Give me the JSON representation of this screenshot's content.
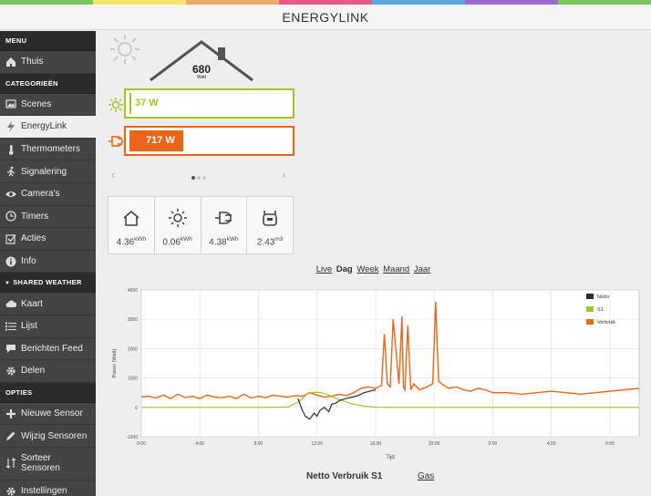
{
  "app": {
    "title": "ENERGYLINK"
  },
  "rainbow": [
    "#7ac75a",
    "#f2e66a",
    "#f0a96a",
    "#e65a8a",
    "#5aa7e0",
    "#9a6ad0",
    "#7ac75a"
  ],
  "sidebar": {
    "sections": [
      {
        "label": "MENU",
        "items": [
          {
            "label": "Thuis",
            "icon": "home-icon"
          }
        ]
      },
      {
        "label": "CATEGORIEËN",
        "items": [
          {
            "label": "Scenes",
            "icon": "image-icon"
          },
          {
            "label": "EnergyLink",
            "icon": "lightning-icon",
            "active": true
          },
          {
            "label": "Thermometers",
            "icon": "thermometer-icon"
          },
          {
            "label": "Signalering",
            "icon": "running-man-icon"
          },
          {
            "label": "Camera's",
            "icon": "eye-icon"
          },
          {
            "label": "Timers",
            "icon": "clock-icon"
          },
          {
            "label": "Acties",
            "icon": "checkbox-icon"
          },
          {
            "label": "Info",
            "icon": "info-icon"
          }
        ]
      },
      {
        "label": "SHARED WEATHER",
        "items": [
          {
            "label": "Kaart",
            "icon": "cloud-icon"
          },
          {
            "label": "Lijst",
            "icon": "list-icon"
          },
          {
            "label": "Berichten Feed",
            "icon": "chat-icon"
          },
          {
            "label": "Delen",
            "icon": "gear-icon"
          }
        ]
      },
      {
        "label": "OPTIES",
        "items": [
          {
            "label": "Nieuwe Sensor",
            "icon": "plus-icon"
          },
          {
            "label": "Wijzig Sensoren",
            "icon": "pencil-icon"
          },
          {
            "label": "Sorteer Sensoren",
            "icon": "sort-icon"
          },
          {
            "label": "Instellingen",
            "icon": "settings-icon"
          }
        ]
      }
    ]
  },
  "house": {
    "value": "680",
    "unit": "Watt"
  },
  "solar_bar": {
    "label": "37 W",
    "color": "#a4c324",
    "fill_fraction": 0.02
  },
  "usage_bar": {
    "label": "717 W",
    "color": "#ea6517",
    "fill_fraction": 0.33
  },
  "carousel": {
    "pages": 3,
    "current": 0
  },
  "summary": [
    {
      "icon": "house-outline-icon",
      "value": "4.36",
      "unit": "kWh"
    },
    {
      "icon": "sun-icon",
      "value": "0.06",
      "unit": "kWh"
    },
    {
      "icon": "plug-icon",
      "value": "4.38",
      "unit": "kWh"
    },
    {
      "icon": "gas-meter-icon",
      "value": "2.43",
      "unit": "m3"
    }
  ],
  "range_tabs": {
    "live": "Live",
    "dag": "Dag",
    "week": "Week",
    "maand": "Maand",
    "jaar": "Jaar"
  },
  "chart_data": {
    "type": "line",
    "xlabel": "Tijd",
    "ylabel": "Power (Watt)",
    "ylim": [
      -1000,
      4000
    ],
    "yticks": [
      -1000,
      0,
      1000,
      2000,
      3000,
      4000
    ],
    "xticks": [
      "0:00",
      "4:00",
      "8:00",
      "12:00",
      "16:00",
      "20:00",
      "0:00",
      "4:00",
      "8:00"
    ],
    "xlim_hours": [
      0,
      34
    ],
    "grid": true,
    "legend": "top-right",
    "series": [
      {
        "name": "Netto",
        "color": "#2b2b2b",
        "x": [
          10.7,
          11.0,
          11.2,
          11.5,
          11.8,
          12.0,
          12.2,
          12.5,
          12.8,
          13.0,
          13.3,
          13.6,
          14.0,
          14.4,
          14.8,
          15.2,
          15.6,
          16.0
        ],
        "y": [
          300,
          -100,
          -300,
          -400,
          -200,
          -300,
          -100,
          0,
          -150,
          100,
          150,
          250,
          300,
          350,
          400,
          500,
          550,
          600
        ]
      },
      {
        "name": "S1",
        "color": "#a4c324",
        "x": [
          0,
          8,
          10,
          10.8,
          11.3,
          11.8,
          12.3,
          12.8,
          13.3,
          13.8,
          14.3,
          14.8,
          15.3,
          16.0,
          17.0,
          18.0,
          34
        ],
        "y": [
          0,
          0,
          10,
          200,
          450,
          520,
          500,
          420,
          300,
          220,
          130,
          80,
          40,
          10,
          0,
          0,
          0
        ]
      },
      {
        "name": "Verbruik",
        "color": "#ea6517",
        "x": [
          0,
          0.5,
          1,
          1.5,
          2,
          2.5,
          3,
          3.5,
          4,
          4.5,
          5,
          5.5,
          6,
          6.5,
          7,
          7.5,
          8,
          8.5,
          9,
          9.5,
          10,
          10.5,
          11,
          11.5,
          12,
          12.5,
          13,
          13.5,
          14,
          14.5,
          15,
          15.5,
          16,
          16.4,
          16.6,
          16.8,
          17.0,
          17.2,
          17.6,
          17.8,
          17.9,
          18.0,
          18.2,
          18.4,
          18.6,
          19.0,
          19.5,
          19.9,
          20.1,
          20.3,
          20.5,
          21,
          21.5,
          22,
          22.5,
          23,
          23.5,
          24,
          25,
          26,
          27,
          28,
          29,
          30,
          31,
          32,
          33,
          34
        ],
        "y": [
          350,
          380,
          320,
          420,
          300,
          450,
          330,
          380,
          300,
          420,
          350,
          330,
          380,
          300,
          450,
          320,
          380,
          330,
          420,
          380,
          350,
          400,
          380,
          500,
          420,
          350,
          380,
          450,
          400,
          500,
          650,
          700,
          650,
          750,
          2500,
          800,
          700,
          3000,
          800,
          3100,
          700,
          600,
          2800,
          600,
          800,
          600,
          700,
          800,
          3600,
          900,
          800,
          650,
          700,
          600,
          550,
          650,
          600,
          500,
          500,
          450,
          500,
          550,
          500,
          450,
          500,
          550,
          600,
          650
        ]
      }
    ]
  },
  "bottom_tabs": {
    "active": "Netto Verbruik S1",
    "other": "Gas"
  }
}
